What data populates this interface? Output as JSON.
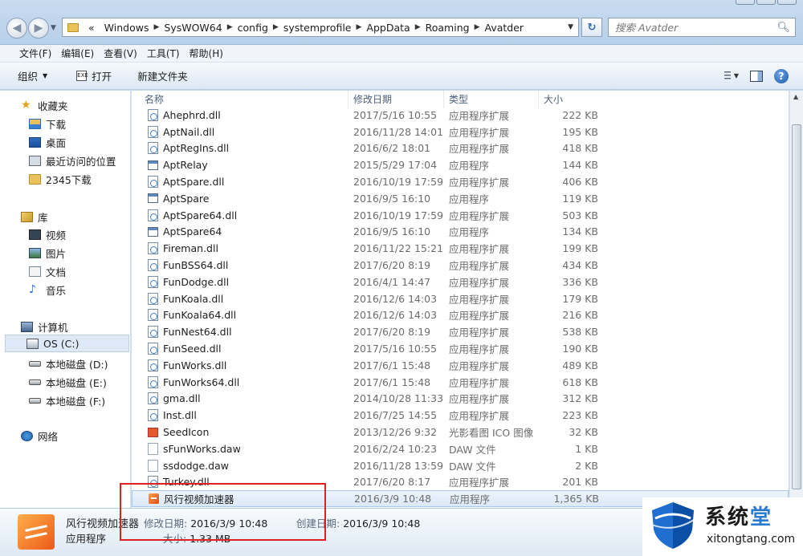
{
  "window": {
    "address": {
      "prefix": "«",
      "crumbs": [
        "Windows",
        "SysWOW64",
        "config",
        "systemprofile",
        "AppData",
        "Roaming",
        "Avatder"
      ],
      "refresh_icon": "refresh-icon"
    },
    "search": {
      "placeholder": "搜索 Avatder"
    }
  },
  "menubar": [
    "文件(F)",
    "编辑(E)",
    "查看(V)",
    "工具(T)",
    "帮助(H)"
  ],
  "toolbar": {
    "organize": "组织",
    "open": "打开",
    "new_folder": "新建文件夹"
  },
  "navpane": {
    "favorites": {
      "label": "收藏夹",
      "items": [
        "下载",
        "桌面",
        "最近访问的位置",
        "2345下载"
      ]
    },
    "libraries": {
      "label": "库",
      "items": [
        "视频",
        "图片",
        "文档",
        "音乐"
      ]
    },
    "computer": {
      "label": "计算机",
      "items": [
        "OS (C:)",
        "本地磁盘 (D:)",
        "本地磁盘 (E:)",
        "本地磁盘 (F:)"
      ]
    },
    "network": {
      "label": "网络"
    }
  },
  "filelist": {
    "headers": {
      "name": "名称",
      "date": "修改日期",
      "type": "类型",
      "size": "大小"
    },
    "rows": [
      {
        "name": "Ahephrd.dll",
        "date": "2017/5/16 10:55",
        "type": "应用程序扩展",
        "size": "222 KB",
        "icon": "dll"
      },
      {
        "name": "AptNail.dll",
        "date": "2016/11/28 14:01",
        "type": "应用程序扩展",
        "size": "195 KB",
        "icon": "dll"
      },
      {
        "name": "AptRegIns.dll",
        "date": "2016/6/2 18:01",
        "type": "应用程序扩展",
        "size": "418 KB",
        "icon": "dll"
      },
      {
        "name": "AptRelay",
        "date": "2015/5/29 17:04",
        "type": "应用程序",
        "size": "144 KB",
        "icon": "exe"
      },
      {
        "name": "AptSpare.dll",
        "date": "2016/10/19 17:59",
        "type": "应用程序扩展",
        "size": "406 KB",
        "icon": "dll"
      },
      {
        "name": "AptSpare",
        "date": "2016/9/5 16:10",
        "type": "应用程序",
        "size": "119 KB",
        "icon": "exe"
      },
      {
        "name": "AptSpare64.dll",
        "date": "2016/10/19 17:59",
        "type": "应用程序扩展",
        "size": "503 KB",
        "icon": "dll"
      },
      {
        "name": "AptSpare64",
        "date": "2016/9/5 16:10",
        "type": "应用程序",
        "size": "134 KB",
        "icon": "exe"
      },
      {
        "name": "Fireman.dll",
        "date": "2016/11/22 15:21",
        "type": "应用程序扩展",
        "size": "199 KB",
        "icon": "dll"
      },
      {
        "name": "FunBSS64.dll",
        "date": "2017/6/20 8:19",
        "type": "应用程序扩展",
        "size": "434 KB",
        "icon": "dll"
      },
      {
        "name": "FunDodge.dll",
        "date": "2016/4/1 14:47",
        "type": "应用程序扩展",
        "size": "336 KB",
        "icon": "dll"
      },
      {
        "name": "FunKoala.dll",
        "date": "2016/12/6 14:03",
        "type": "应用程序扩展",
        "size": "179 KB",
        "icon": "dll"
      },
      {
        "name": "FunKoala64.dll",
        "date": "2016/12/6 14:03",
        "type": "应用程序扩展",
        "size": "216 KB",
        "icon": "dll"
      },
      {
        "name": "FunNest64.dll",
        "date": "2017/6/20 8:19",
        "type": "应用程序扩展",
        "size": "538 KB",
        "icon": "dll"
      },
      {
        "name": "FunSeed.dll",
        "date": "2017/5/16 10:55",
        "type": "应用程序扩展",
        "size": "190 KB",
        "icon": "dll"
      },
      {
        "name": "FunWorks.dll",
        "date": "2017/6/1 15:48",
        "type": "应用程序扩展",
        "size": "489 KB",
        "icon": "dll"
      },
      {
        "name": "FunWorks64.dll",
        "date": "2017/6/1 15:48",
        "type": "应用程序扩展",
        "size": "618 KB",
        "icon": "dll"
      },
      {
        "name": "gma.dll",
        "date": "2014/10/28 11:33",
        "type": "应用程序扩展",
        "size": "312 KB",
        "icon": "dll"
      },
      {
        "name": "Inst.dll",
        "date": "2016/7/25 14:55",
        "type": "应用程序扩展",
        "size": "223 KB",
        "icon": "dll"
      },
      {
        "name": "SeedIcon",
        "date": "2013/12/26 9:32",
        "type": "光影看图 ICO 图像",
        "size": "32 KB",
        "icon": "ico"
      },
      {
        "name": "sFunWorks.daw",
        "date": "2016/2/24 10:23",
        "type": "DAW 文件",
        "size": "1 KB",
        "icon": "daw"
      },
      {
        "name": "ssdodge.daw",
        "date": "2016/11/28 13:59",
        "type": "DAW 文件",
        "size": "2 KB",
        "icon": "daw"
      },
      {
        "name": "Turkey.dll",
        "date": "2017/6/20 8:17",
        "type": "应用程序扩展",
        "size": "201 KB",
        "icon": "dll"
      },
      {
        "name": "风行视频加速器",
        "date": "2016/3/9 10:48",
        "type": "应用程序",
        "size": "1,365 KB",
        "icon": "app",
        "selected": true
      }
    ]
  },
  "details": {
    "name": "风行视频加速器",
    "type": "应用程序",
    "modified_label": "修改日期:",
    "modified": "2016/3/9 10:48",
    "created_label": "创建日期:",
    "created": "2016/3/9 10:48",
    "size_label": "大小:",
    "size": "1.33 MB"
  },
  "watermark": {
    "title_part1": "系统",
    "title_part2": "堂",
    "url": "xitongtang.com"
  },
  "colors": {
    "selection": "#dbe8f8",
    "highlight_box": "#e02020",
    "chrome": "#c8dbef"
  }
}
